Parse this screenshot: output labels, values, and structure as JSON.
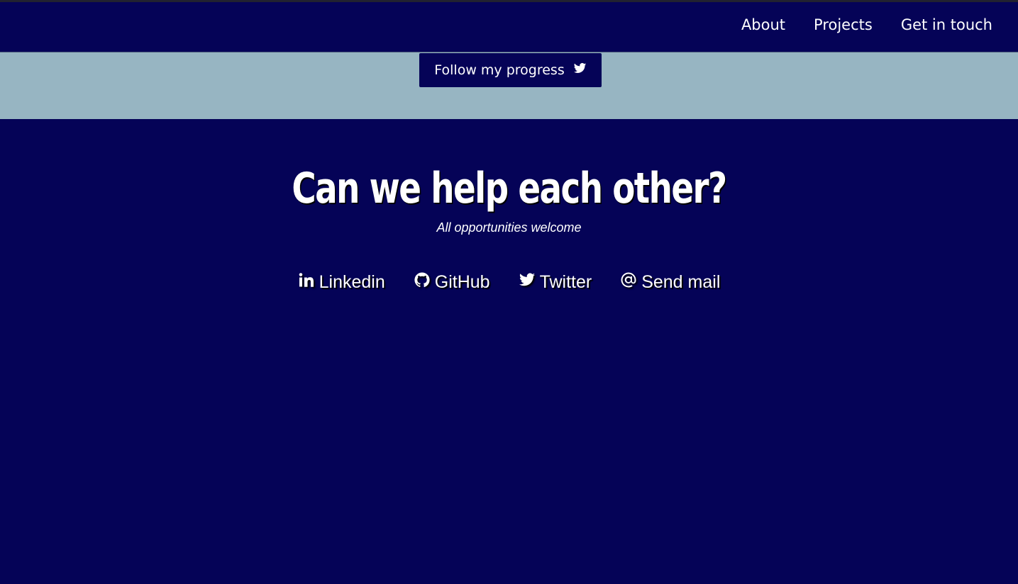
{
  "nav": {
    "links": [
      {
        "label": "About"
      },
      {
        "label": "Projects"
      },
      {
        "label": "Get in touch"
      }
    ]
  },
  "banner": {
    "button_label": "Follow my progress",
    "button_icon": "twitter-icon"
  },
  "contact": {
    "title": "Can we help each other?",
    "subtitle": "All opportunities welcome",
    "links": [
      {
        "label": "Linkedin",
        "icon": "linkedin-icon"
      },
      {
        "label": "GitHub",
        "icon": "github-icon"
      },
      {
        "label": "Twitter",
        "icon": "twitter-icon"
      },
      {
        "label": "Send mail",
        "icon": "at-sign-icon"
      }
    ]
  },
  "colors": {
    "background": "#050357",
    "band": "#97b5c2",
    "text": "#ffffff"
  }
}
